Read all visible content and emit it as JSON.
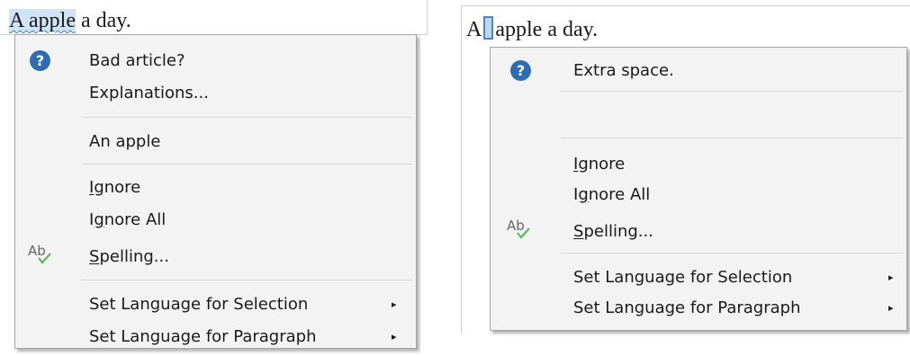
{
  "left": {
    "doc": {
      "selected_word": "A apple",
      "rest": " a day."
    },
    "menu": {
      "suggestion_title": "Bad article?",
      "explanations": "Explanations...",
      "replacement": "An apple",
      "ignore": "Ignore",
      "ignore_all": "Ignore All",
      "spelling": "Spelling...",
      "set_lang_selection": "Set Language for Selection",
      "set_lang_paragraph": "Set Language for Paragraph"
    }
  },
  "right": {
    "doc": {
      "before": "A",
      "after": "apple a day."
    },
    "menu": {
      "suggestion_title": "Extra space.",
      "ignore": "Ignore",
      "ignore_all": "Ignore All",
      "spelling": "Spelling...",
      "set_lang_selection": "Set Language for Selection",
      "set_lang_paragraph": "Set Language for Paragraph"
    }
  },
  "icons": {
    "help": "help-icon",
    "spelling": "spell-check-icon",
    "submenu": "submenu-arrow-icon"
  },
  "colors": {
    "menu_bg": "#f3f3f3",
    "selection": "#cfe3f5",
    "accent": "#2f6db3",
    "check": "#5cb85c"
  }
}
